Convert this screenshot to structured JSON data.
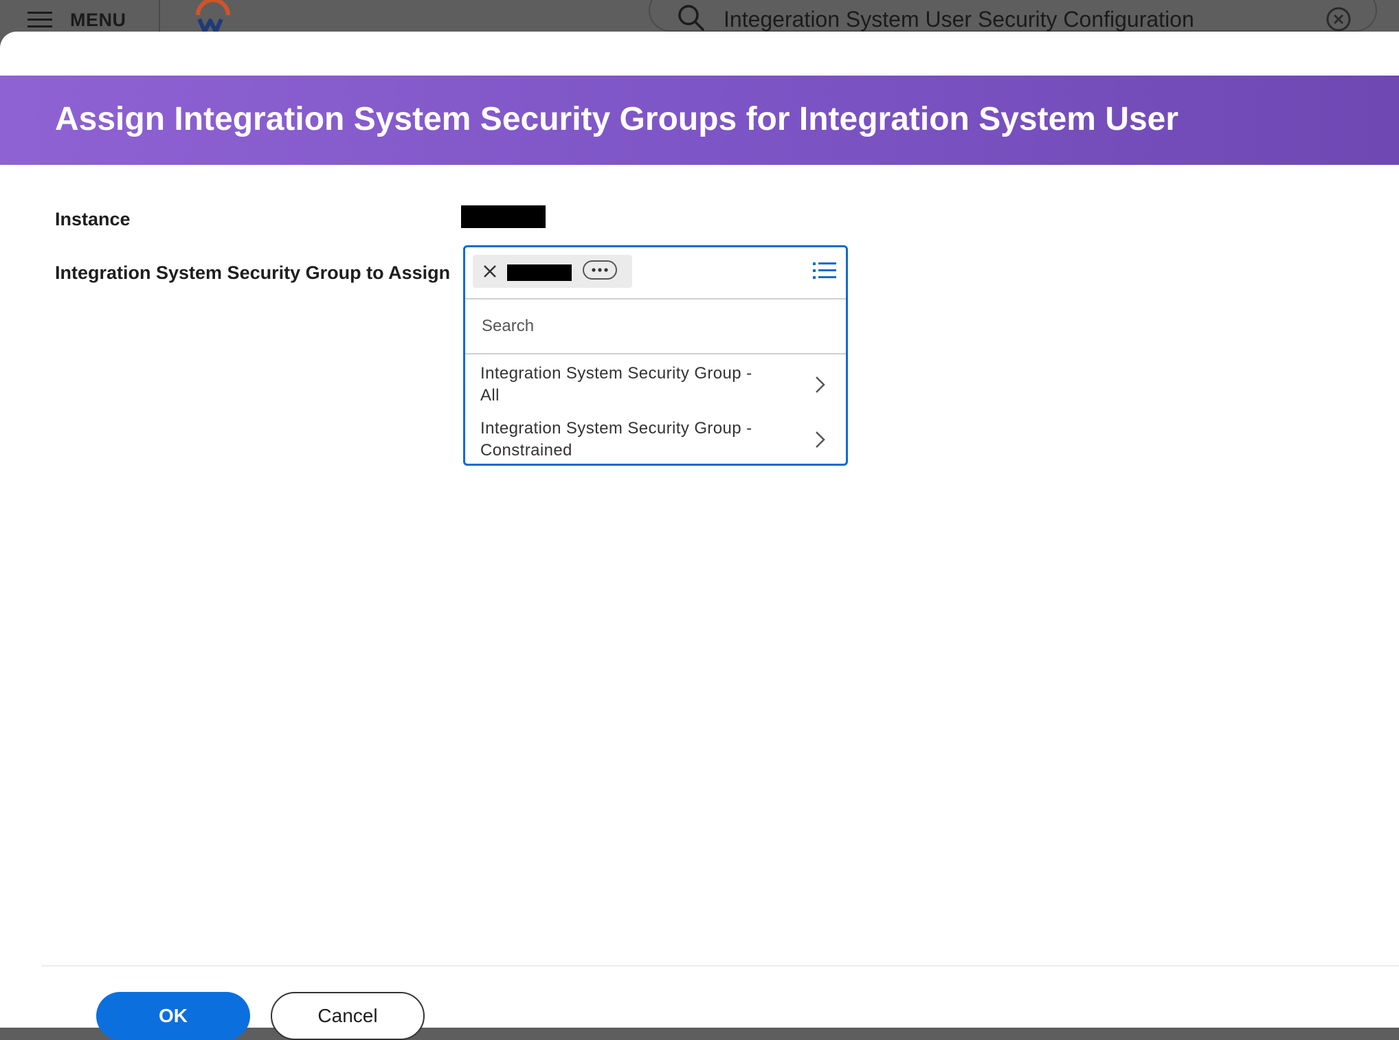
{
  "topbar": {
    "menu_label": "MENU",
    "search_value": "Integeration System User Security Configuration"
  },
  "modal": {
    "title": "Assign Integration System Security Groups for Integration System User",
    "fields": {
      "instance_label": "Instance",
      "group_label": "Integration System Security Group to Assign"
    },
    "prompt": {
      "search_placeholder": "Search",
      "options": [
        {
          "label": "Integration System Security Group - All"
        },
        {
          "label": "Integration System Security Group - Constrained"
        }
      ]
    },
    "buttons": {
      "ok": "OK",
      "cancel": "Cancel"
    }
  },
  "colors": {
    "header_gradient_start": "#8f62d3",
    "header_gradient_end": "#6f48b4",
    "primary_blue": "#0b6fde",
    "focus_border": "#0b6ccf",
    "logo_arc": "#d2532a",
    "logo_w": "#1d3b78"
  },
  "icons": {
    "menu": "hamburger-icon",
    "search": "search-icon",
    "clear": "clear-circle-x-icon",
    "remove_pill": "close-icon",
    "related_actions": "more-horizontal-icon",
    "list": "list-icon",
    "option_arrow": "chevron-right-icon"
  }
}
